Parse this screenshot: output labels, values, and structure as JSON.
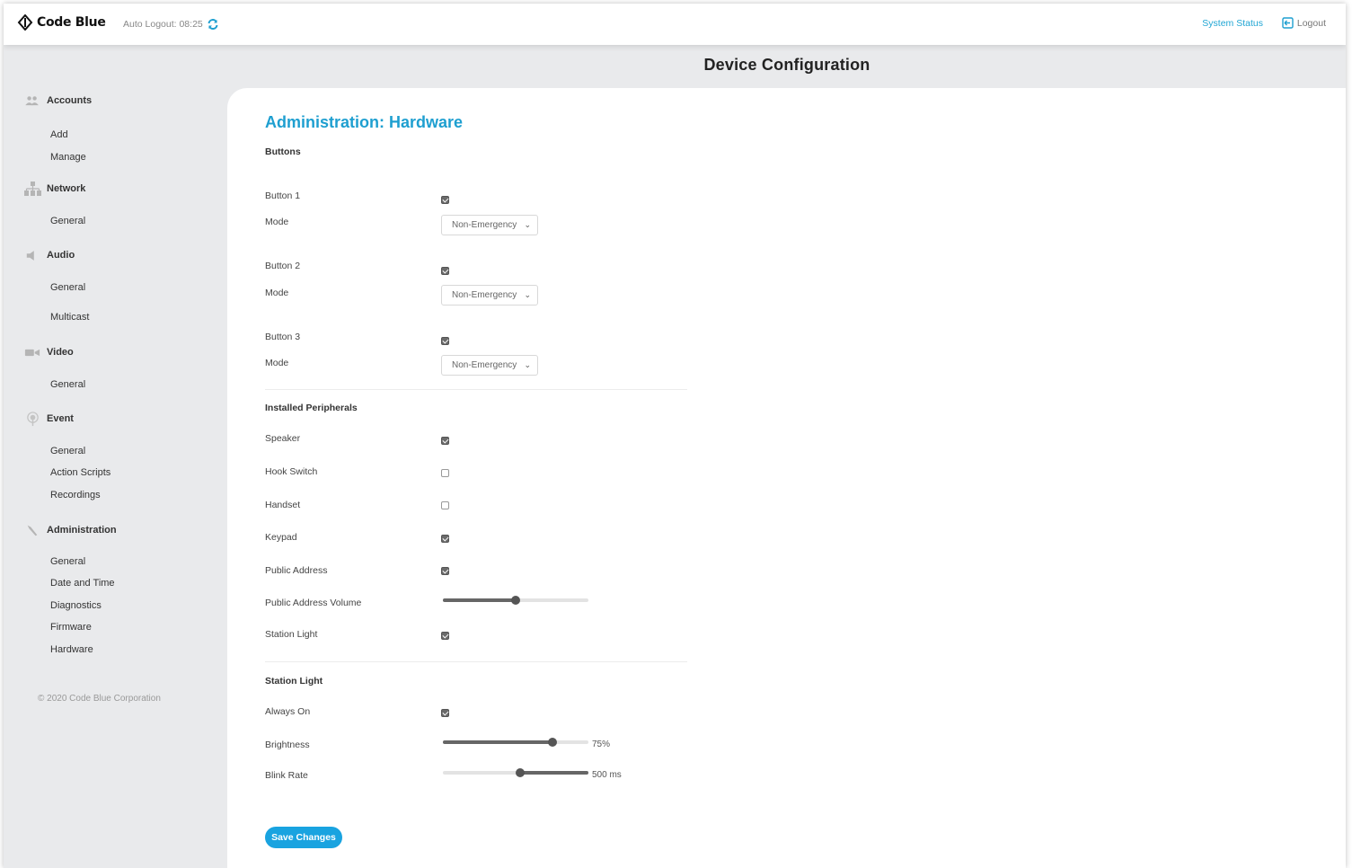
{
  "header": {
    "brand": "Code Blue",
    "auto_logout": "Auto Logout: 08:25",
    "system_status": "System Status",
    "logout": "Logout"
  },
  "page_title": "Device Configuration",
  "sidebar": {
    "sections": [
      {
        "label": "Accounts",
        "icon": "users-icon",
        "items": [
          "Add",
          "Manage"
        ]
      },
      {
        "label": "Network",
        "icon": "network-icon",
        "items": [
          "General"
        ]
      },
      {
        "label": "Audio",
        "icon": "speaker-icon",
        "items": [
          "General",
          "Multicast"
        ]
      },
      {
        "label": "Video",
        "icon": "camera-icon",
        "items": [
          "General"
        ]
      },
      {
        "label": "Event",
        "icon": "event-icon",
        "items": [
          "General",
          "Action Scripts",
          "Recordings"
        ]
      },
      {
        "label": "Administration",
        "icon": "wrench-icon",
        "items": [
          "General",
          "Date and Time",
          "Diagnostics",
          "Firmware",
          "Hardware"
        ]
      }
    ],
    "copyright": "© 2020 Code Blue Corporation"
  },
  "content": {
    "title": "Administration: Hardware",
    "buttons_group": "Buttons",
    "buttons": [
      {
        "label": "Button 1",
        "enabled": true,
        "mode_label": "Mode",
        "mode": "Non-Emergency"
      },
      {
        "label": "Button 2",
        "enabled": true,
        "mode_label": "Mode",
        "mode": "Non-Emergency"
      },
      {
        "label": "Button 3",
        "enabled": true,
        "mode_label": "Mode",
        "mode": "Non-Emergency"
      }
    ],
    "peripherals_group": "Installed Peripherals",
    "peripherals": [
      {
        "label": "Speaker",
        "checked": true
      },
      {
        "label": "Hook Switch",
        "checked": false
      },
      {
        "label": "Handset",
        "checked": false
      },
      {
        "label": "Keypad",
        "checked": true
      },
      {
        "label": "Public Address",
        "checked": true
      }
    ],
    "pa_volume_label": "Public Address Volume",
    "pa_volume_fraction": 0.5,
    "station_light_peripheral": {
      "label": "Station Light",
      "checked": true
    },
    "station_light_group": "Station Light",
    "always_on": {
      "label": "Always On",
      "checked": true
    },
    "brightness": {
      "label": "Brightness",
      "value": "75%",
      "fraction": 0.75
    },
    "blink_rate": {
      "label": "Blink Rate",
      "value": "500 ms",
      "fraction": 0.53
    },
    "save_label": "Save Changes"
  },
  "colors": {
    "accent": "#1e9fd0",
    "button": "#19a3e0",
    "sidebar_bg": "#e9eaec"
  }
}
